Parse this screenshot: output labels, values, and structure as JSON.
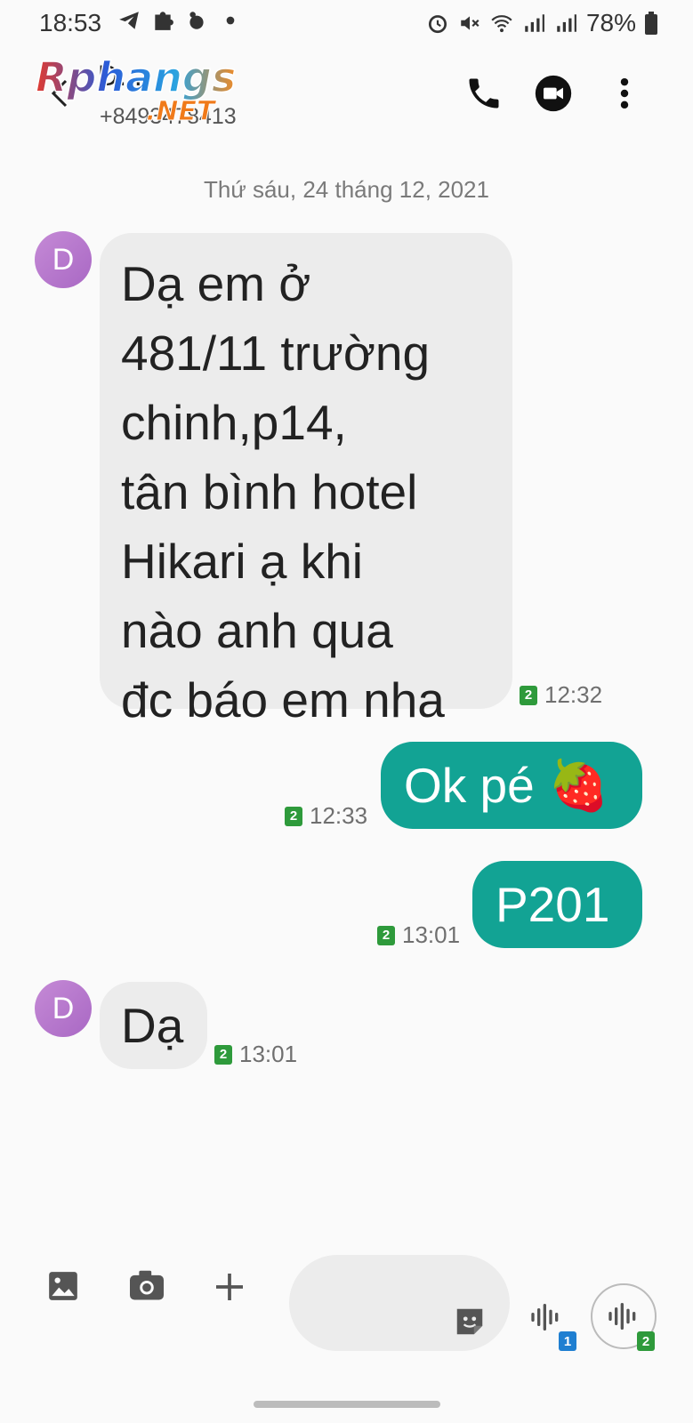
{
  "status_bar": {
    "time": "18:53",
    "battery": "78%"
  },
  "header": {
    "contact_name": "D...",
    "contact_number": "+8493478413",
    "logo_text_main": "Rphangs",
    "logo_text_sub": ".NET",
    "icons": [
      "call-icon",
      "video-call-icon",
      "more-options-icon"
    ]
  },
  "conversation": {
    "date": "Thứ sáu, 24 tháng 12, 2021",
    "messages": [
      {
        "direction": "incoming",
        "avatar": "D",
        "lines": [
          "Dạ em ở",
          "481/11 trường",
          "chinh,p14,",
          "tân bình hotel",
          "Hikari ạ khi",
          "nào anh qua",
          "đc báo em nha"
        ],
        "sim": "2",
        "time": "12:32"
      },
      {
        "direction": "outgoing",
        "text": "Ok pé 🍓",
        "sim": "2",
        "time": "12:33"
      },
      {
        "direction": "outgoing",
        "text": "P201",
        "sim": "2",
        "time": "13:01"
      },
      {
        "direction": "incoming",
        "avatar": "D",
        "text": "Dạ",
        "sim": "2",
        "time": "13:01"
      }
    ]
  },
  "composer": {
    "voice_sim_1": "1",
    "voice_sim_2": "2"
  },
  "colors": {
    "incoming_bubble": "#ececec",
    "outgoing_bubble": "#12a394",
    "avatar": "#b77ccf",
    "sim_badge": "#2e9a3b"
  }
}
